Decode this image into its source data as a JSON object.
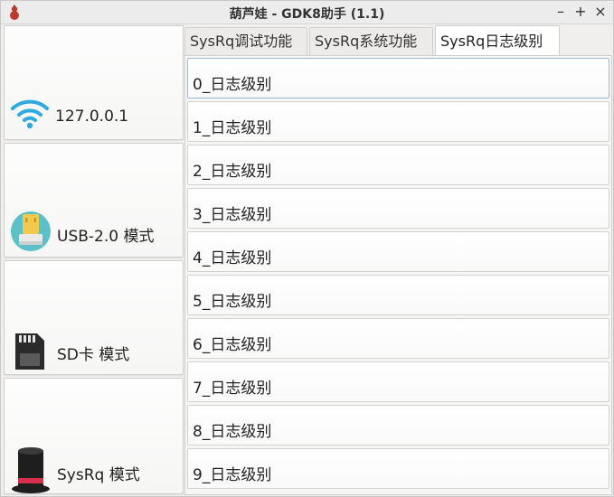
{
  "window": {
    "title": "葫芦娃 - GDK8助手 (1.1)",
    "controls": {
      "minimize": "–",
      "maximize": "+",
      "close": "×"
    }
  },
  "sidebar": {
    "items": [
      {
        "label": "127.0.0.1",
        "icon": "wifi-icon"
      },
      {
        "label": "USB-2.0 模式",
        "icon": "usb-drive-icon"
      },
      {
        "label": "SD卡 模式",
        "icon": "sd-card-icon"
      },
      {
        "label": "SysRq 模式",
        "icon": "magic-hat-icon"
      }
    ]
  },
  "tabs": [
    {
      "label": "SysRq调试功能",
      "active": false
    },
    {
      "label": "SysRq系统功能",
      "active": false
    },
    {
      "label": "SysRq日志级别",
      "active": true
    }
  ],
  "levels": [
    "0_日志级别",
    "1_日志级别",
    "2_日志级别",
    "3_日志级别",
    "4_日志级别",
    "5_日志级别",
    "6_日志级别",
    "7_日志级别",
    "8_日志级别",
    "9_日志级别"
  ],
  "colors": {
    "wifi": "#2eaadf",
    "usb_circle": "#5bc0c8",
    "usb_body": "#f2c94c",
    "sd_card": "#2b2b2b",
    "hat": "#1e1e1e",
    "hat_band": "#d8304a",
    "app_icon": "#c0392b"
  }
}
